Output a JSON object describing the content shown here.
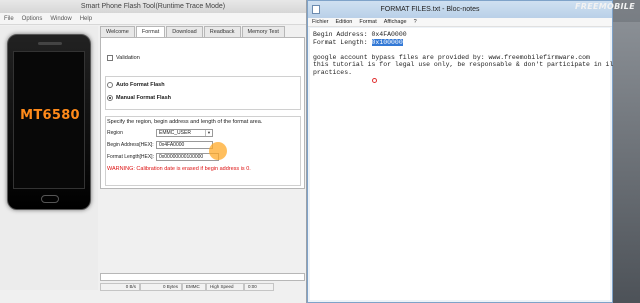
{
  "flash_tool": {
    "title": "Smart Phone Flash Tool(Runtime Trace Mode)",
    "menu": [
      "File",
      "Options",
      "Window",
      "Help"
    ],
    "phone_label": "MT6580",
    "tabs": [
      "Welcome",
      "Format",
      "Download",
      "Readback",
      "Memory Test"
    ],
    "validation_label": "Validation",
    "auto_format_label": "Auto Format Flash",
    "manual_format_label": "Manual Format Flash",
    "manual_format_selected": true,
    "instructions": "Specify the region, begin address and length of the format area.",
    "region_label": "Region",
    "region_value": "EMMC_USER",
    "begin_label": "Begin Address[HEX]:",
    "begin_value": "0x4FA0000",
    "length_label": "Format Length[HEX]:",
    "length_value": "0x00000000100000",
    "warning": "WARNING: Calibration date is erased if begin address is 0.",
    "status": {
      "speed": "0 B/s",
      "size": "0 Bytes",
      "storage": "EMMC",
      "mode": "High Speed",
      "time": "0:00"
    }
  },
  "notepad": {
    "title": "FORMAT FILES.txt - Bloc-notes",
    "menu": [
      "Fichier",
      "Edition",
      "Format",
      "Affichage",
      "?"
    ],
    "line1": "Begin Address: 0x4FA0000",
    "line2_prefix": "Format Length: ",
    "line2_selected": "0x100000",
    "line3": "google account bypass files are provided by: www.freemobilefirmware.com",
    "line4": "this tutorial is for legal use only, be responsable & don't participate in illegal",
    "line5": "practices."
  },
  "brand": "FREEMOBILE",
  "watermark": "FREEMOBILE"
}
